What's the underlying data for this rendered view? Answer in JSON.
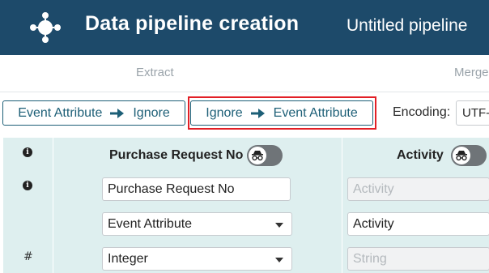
{
  "header": {
    "app_title": "Data pipeline creation",
    "pipeline_name": "Untitled pipeline",
    "background_color": "#1d4a6a"
  },
  "steps": {
    "extract": "Extract",
    "merge": "Merge"
  },
  "toolbar": {
    "event_to_ignore": {
      "from": "Event Attribute",
      "to": "Ignore"
    },
    "ignore_to_event": {
      "from": "Ignore",
      "to": "Event Attribute"
    },
    "encoding_label": "Encoding:",
    "encoding_value": "UTF-",
    "highlight_color": "#e21f26"
  },
  "icons": {
    "info": "i",
    "hash": "#"
  },
  "columns": [
    {
      "title": "Purchase Request No",
      "name_value": "Purchase Request No",
      "type_select": "Event Attribute",
      "data_type_select": "Integer"
    },
    {
      "title": "Activity",
      "name_placeholder": "Activity",
      "type_select": "Activity",
      "data_type_placeholder": "String"
    }
  ],
  "colors": {
    "accent": "#1d5f77",
    "table_bg": "#deefef"
  }
}
